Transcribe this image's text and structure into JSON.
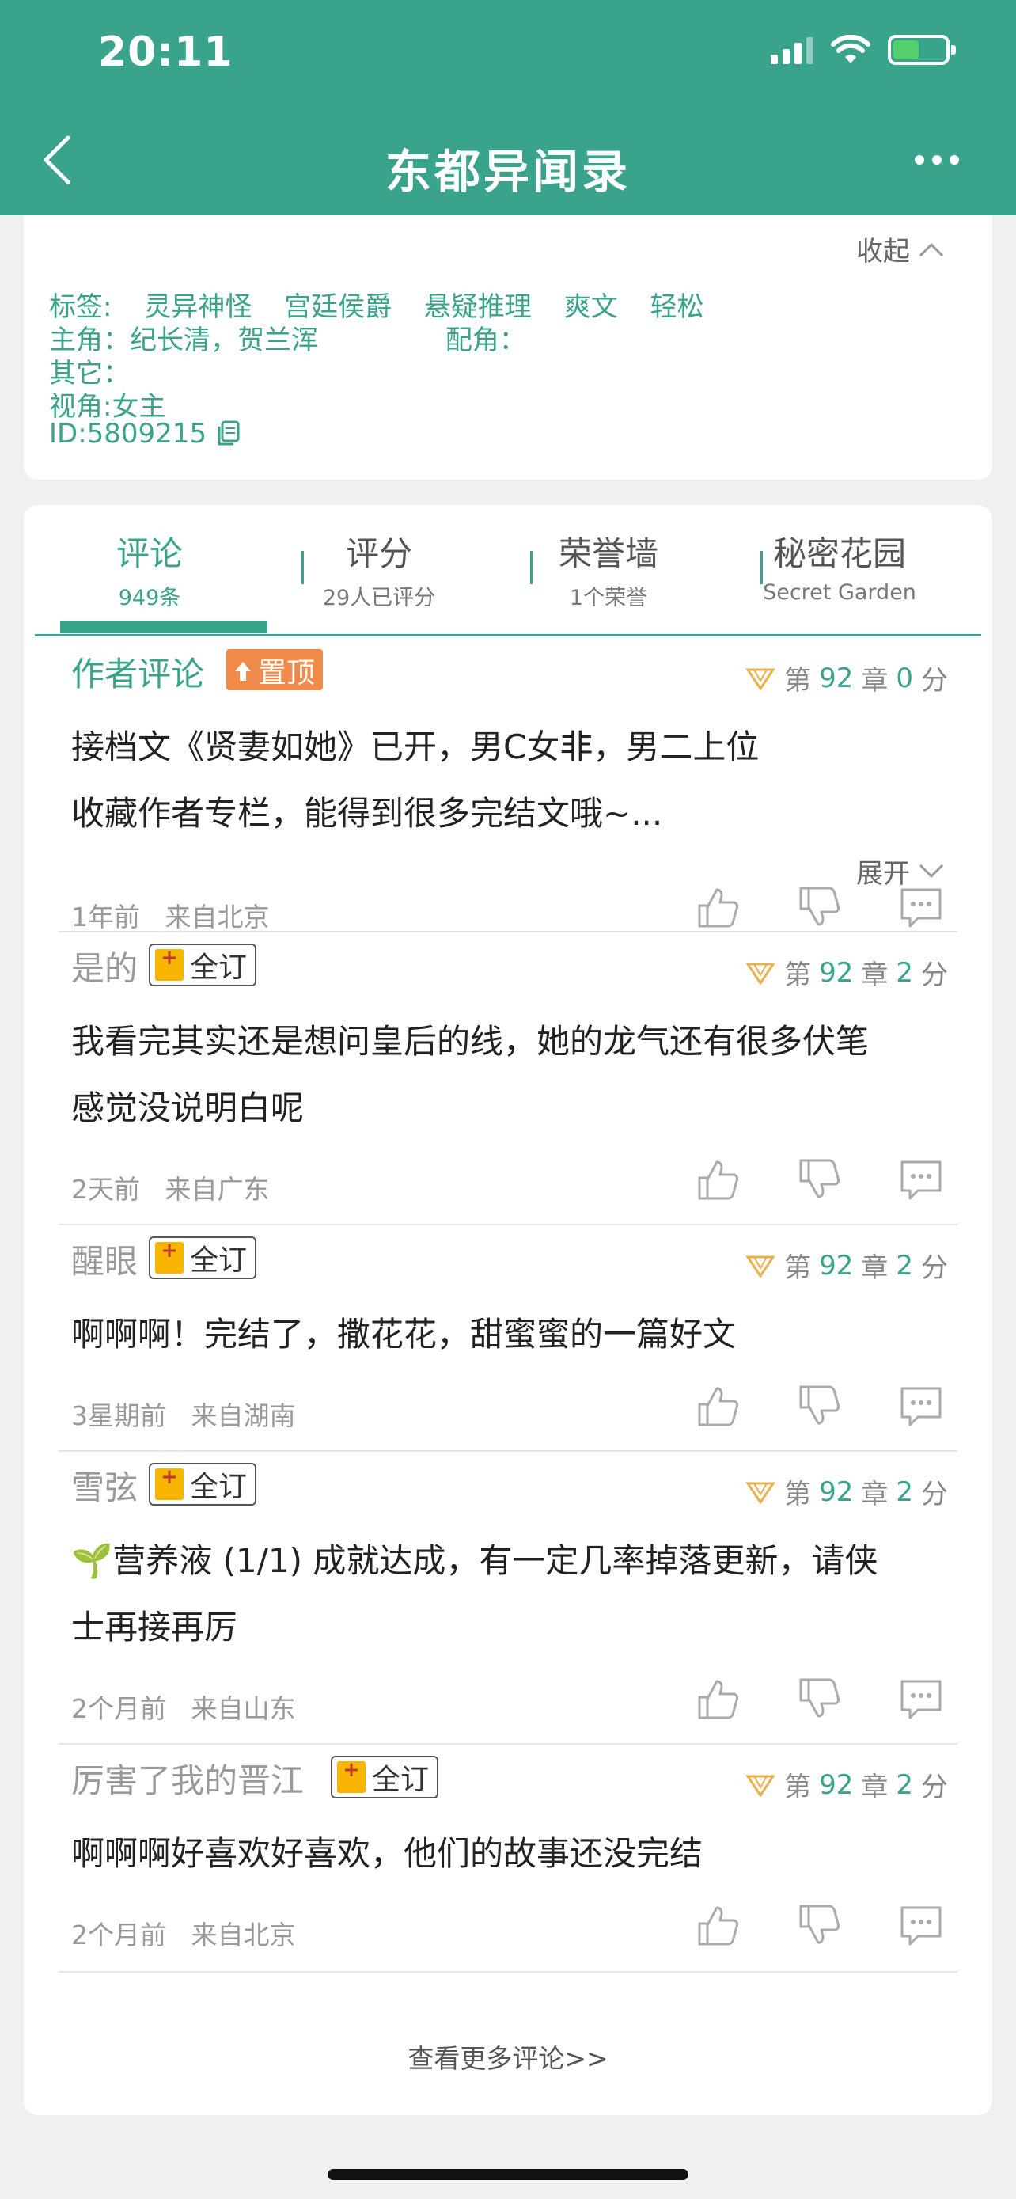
{
  "status_bar": {
    "time": "20:11",
    "battery_level": 0.45
  },
  "header": {
    "title": "东都异闻录",
    "back_icon": "chevron-left-icon",
    "more_icon": "more-dots-icon"
  },
  "info": {
    "collapse_label": "收起",
    "tags_label": "标签:",
    "tags": [
      "灵异神怪",
      "宫廷侯爵",
      "悬疑推理",
      "爽文",
      "轻松"
    ],
    "protagonists": "主角：纪长清，贺兰浑",
    "supporting": "配角：",
    "others": "其它：",
    "perspective": "视角:女主",
    "id": "ID:5809215"
  },
  "tabs": [
    {
      "label": "评论",
      "sub": "949条",
      "active": true
    },
    {
      "label": "评分",
      "sub": "29人已评分",
      "active": false
    },
    {
      "label": "荣誉墙",
      "sub": "1个荣誉",
      "active": false
    },
    {
      "label": "秘密花园",
      "sub": "Secret Garden",
      "active": false
    }
  ],
  "comments": [
    {
      "name": "作者评论",
      "badge": "置顶",
      "chapter_prefix": "第",
      "chapter": "92",
      "chapter_suffix": "章",
      "score": "0",
      "score_suffix": "分",
      "body_1": "接档文《贤妻如她》已开，男C女非，男二上位",
      "body_2": "收藏作者专栏，能得到很多完结文哦~...",
      "expand_label": "展开",
      "time": "1年前",
      "location": "来自北京"
    },
    {
      "name": "是的",
      "badge": "全订",
      "chapter_prefix": "第",
      "chapter": "92",
      "chapter_suffix": "章",
      "score": "2",
      "score_suffix": "分",
      "body_1": "我看完其实还是想问皇后的线，她的龙气还有很多伏笔",
      "body_2": "感觉没说明白呢",
      "time": "2天前",
      "location": "来自广东"
    },
    {
      "name": "醒眼",
      "badge": "全订",
      "chapter_prefix": "第",
      "chapter": "92",
      "chapter_suffix": "章",
      "score": "2",
      "score_suffix": "分",
      "body_1": "啊啊啊！完结了，撒花花，甜蜜蜜的一篇好文",
      "time": "3星期前",
      "location": "来自湖南"
    },
    {
      "name": "雪弦",
      "badge": "全订",
      "chapter_prefix": "第",
      "chapter": "92",
      "chapter_suffix": "章",
      "score": "2",
      "score_suffix": "分",
      "body_1": "🌱营养液 (1/1) 成就达成，有一定几率掉落更新，请侠",
      "body_2": "士再接再厉",
      "time": "2个月前",
      "location": "来自山东"
    },
    {
      "name": "厉害了我的晋江",
      "badge": "全订",
      "chapter_prefix": "第",
      "chapter": "92",
      "chapter_suffix": "章",
      "score": "2",
      "score_suffix": "分",
      "body_1": "啊啊啊好喜欢好喜欢，他们的故事还没完结",
      "time": "2个月前",
      "location": "来自北京"
    }
  ],
  "more_comments_label": "查看更多评论>>",
  "colors": {
    "brand": "#3aa38c",
    "pin_badge": "#f08a4b",
    "bookmark": "#f7b500"
  }
}
